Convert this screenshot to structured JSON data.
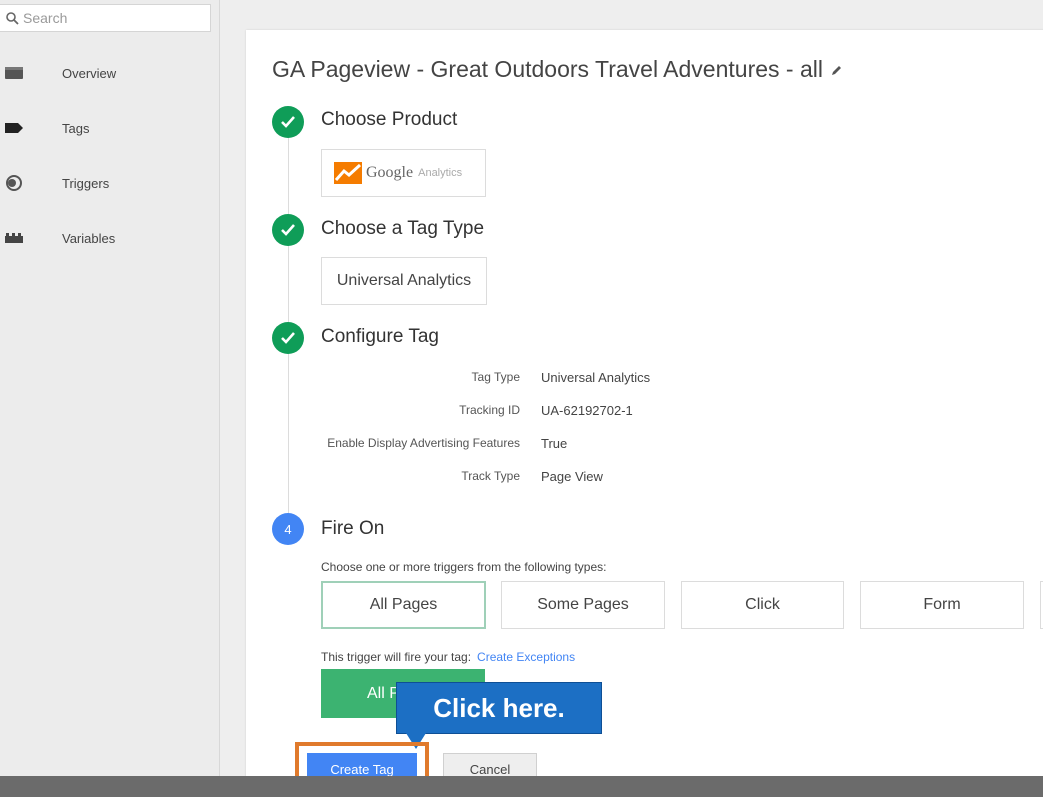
{
  "search": {
    "placeholder": "Search"
  },
  "sidebar": {
    "items": [
      {
        "label": "Overview",
        "icon": "folder-icon"
      },
      {
        "label": "Tags",
        "icon": "tag-icon"
      },
      {
        "label": "Triggers",
        "icon": "trigger-icon"
      },
      {
        "label": "Variables",
        "icon": "blocks-icon"
      }
    ]
  },
  "page": {
    "title": "GA Pageview - Great Outdoors Travel Adventures - all"
  },
  "steps": {
    "product": {
      "label": "Choose Product",
      "google": "Google",
      "analytics": "Analytics"
    },
    "tag_type": {
      "label": "Choose a Tag Type",
      "value": "Universal Analytics"
    },
    "configure": {
      "label": "Configure Tag",
      "rows": [
        {
          "key": "Tag Type",
          "value": "Universal Analytics"
        },
        {
          "key": "Tracking ID",
          "value": "UA-62192702-1"
        },
        {
          "key": "Enable Display Advertising Features",
          "value": "True"
        },
        {
          "key": "Track Type",
          "value": "Page View"
        }
      ]
    },
    "fire_on": {
      "number": "4",
      "label": "Fire On",
      "hint": "Choose one or more triggers from the following types:",
      "triggers": [
        "All Pages",
        "Some Pages",
        "Click",
        "Form"
      ],
      "will_fire": "This trigger will fire your tag:",
      "exceptions_link": "Create Exceptions",
      "selected_trigger_partial": "All P"
    }
  },
  "callout": {
    "text": "Click here."
  },
  "actions": {
    "create": "Create Tag",
    "cancel": "Cancel"
  },
  "colors": {
    "accent": "#4285f4",
    "done": "#0f9d58",
    "callout": "#1c6fc4",
    "highlight": "#e07a2c"
  }
}
